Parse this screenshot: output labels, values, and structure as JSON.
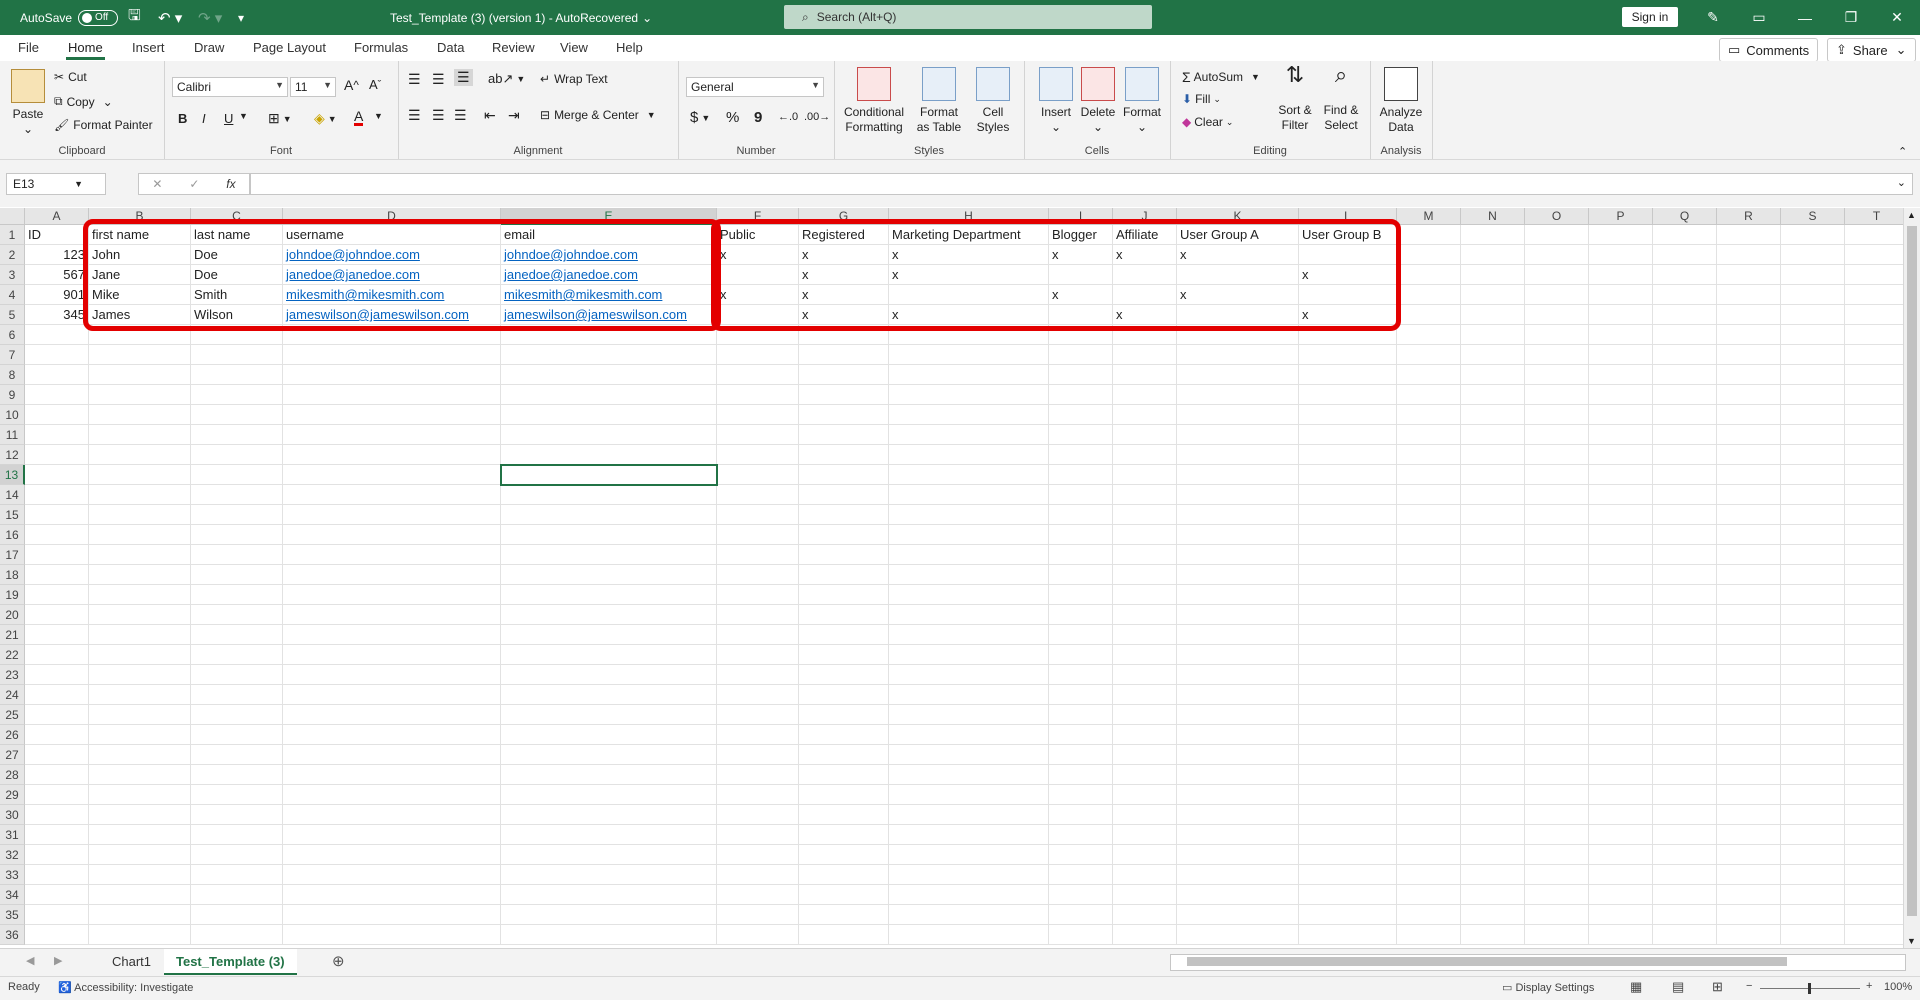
{
  "titlebar": {
    "autosave_label": "AutoSave",
    "autosave_state": "Off",
    "file_title": "Test_Template (3) (version 1)  -  AutoRecovered",
    "search_placeholder": "Search (Alt+Q)",
    "signin_label": "Sign in"
  },
  "tabs": [
    "File",
    "Home",
    "Insert",
    "Draw",
    "Page Layout",
    "Formulas",
    "Data",
    "Review",
    "View",
    "Help"
  ],
  "active_tab": "Home",
  "tab_actions": {
    "comments": "Comments",
    "share": "Share"
  },
  "ribbon": {
    "clipboard": {
      "paste": "Paste",
      "cut": "Cut",
      "copy": "Copy",
      "format_painter": "Format Painter",
      "label": "Clipboard"
    },
    "font": {
      "name": "Calibri",
      "size": "11",
      "bold": "B",
      "italic": "I",
      "underline": "U",
      "label": "Font"
    },
    "alignment": {
      "wrap": "Wrap Text",
      "merge": "Merge & Center",
      "label": "Alignment"
    },
    "number": {
      "format": "General",
      "currency": "$",
      "percent": "%",
      "comma": "9",
      "label": "Number"
    },
    "styles": {
      "conditional": "Conditional Formatting",
      "format_table": "Format as Table",
      "cell_styles": "Cell Styles",
      "label": "Styles"
    },
    "cells": {
      "insert": "Insert",
      "delete": "Delete",
      "format": "Format",
      "label": "Cells"
    },
    "editing": {
      "autosum": "AutoSum",
      "fill": "Fill",
      "clear": "Clear",
      "sort": "Sort & Filter",
      "find": "Find & Select",
      "label": "Editing"
    },
    "analysis": {
      "analyze": "Analyze Data",
      "label": "Analysis"
    }
  },
  "formula_bar": {
    "name_box": "E13",
    "fx": "fx",
    "value": ""
  },
  "columns": [
    "A",
    "B",
    "C",
    "D",
    "E",
    "F",
    "G",
    "H",
    "I",
    "J",
    "K",
    "L",
    "M",
    "N",
    "O",
    "P",
    "Q",
    "R",
    "S",
    "T"
  ],
  "rows_visible": 36,
  "selected_cell": "E13",
  "sheet": {
    "header": [
      "ID",
      "first name",
      "last name",
      "username",
      "email",
      "Public",
      "Registered",
      "Marketing Department",
      "Blogger",
      "Affiliate",
      "User Group A",
      "User Group B"
    ],
    "rows": [
      [
        "123",
        "John",
        "Doe",
        "johndoe@johndoe.com",
        "johndoe@johndoe.com",
        "x",
        "x",
        "x",
        "x",
        "x",
        "x",
        ""
      ],
      [
        "567",
        "Jane",
        "Doe",
        "janedoe@janedoe.com",
        "janedoe@janedoe.com",
        "",
        "x",
        "x",
        "",
        "",
        "",
        "x"
      ],
      [
        "901",
        "Mike",
        "Smith",
        "mikesmith@mikesmith.com",
        "mikesmith@mikesmith.com",
        "x",
        "x",
        "",
        "x",
        "",
        "x",
        ""
      ],
      [
        "345",
        "James",
        "Wilson",
        "jameswilson@jameswilson.com",
        "jameswilson@jameswilson.com",
        "",
        "x",
        "x",
        "",
        "x",
        "",
        "x"
      ]
    ]
  },
  "sheet_tabs": [
    "Chart1",
    "Test_Template (3)"
  ],
  "active_sheet": "Test_Template (3)",
  "status": {
    "ready": "Ready",
    "accessibility": "Accessibility: Investigate",
    "display": "Display Settings",
    "zoom": "100%"
  },
  "colors": {
    "brand": "#217346",
    "highlight": "#e30000",
    "link": "#0563c1"
  }
}
